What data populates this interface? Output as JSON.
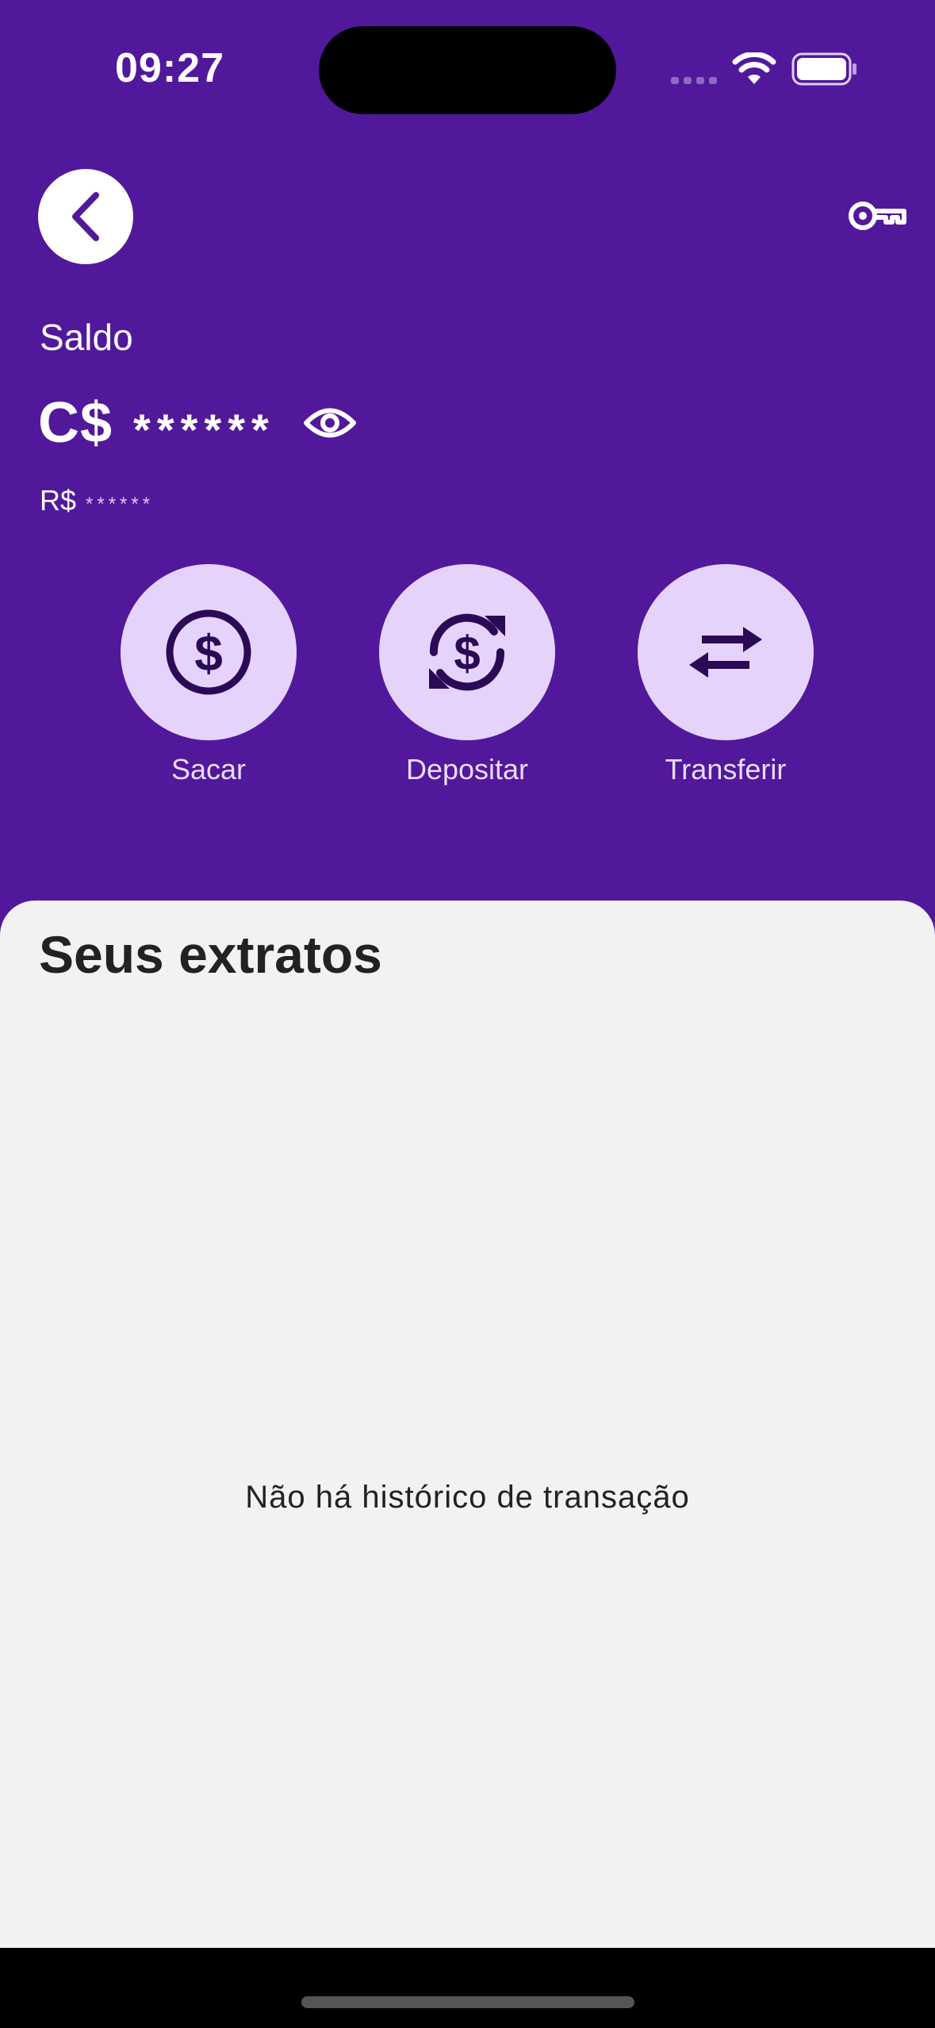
{
  "status_bar": {
    "time": "09:27"
  },
  "header": {
    "back_icon": "chevron-left-icon",
    "key_icon": "key-icon"
  },
  "balance": {
    "label": "Saldo",
    "currency": "C$",
    "hidden_value": "******",
    "toggle_icon": "eye-icon",
    "secondary_currency": "R$",
    "secondary_hidden_value": "******"
  },
  "actions": [
    {
      "label": "Sacar",
      "icon": "dollar-circle-icon"
    },
    {
      "label": "Depositar",
      "icon": "dollar-refresh-icon"
    },
    {
      "label": "Transferir",
      "icon": "transfer-arrows-icon"
    }
  ],
  "statements": {
    "title": "Seus extratos",
    "empty_message": "Não há histórico de transação"
  },
  "colors": {
    "brand_purple": "#52189C",
    "action_circle": "#E5D3FB",
    "icon_dark": "#2A0A57",
    "sheet_background": "#F2F2F2"
  }
}
